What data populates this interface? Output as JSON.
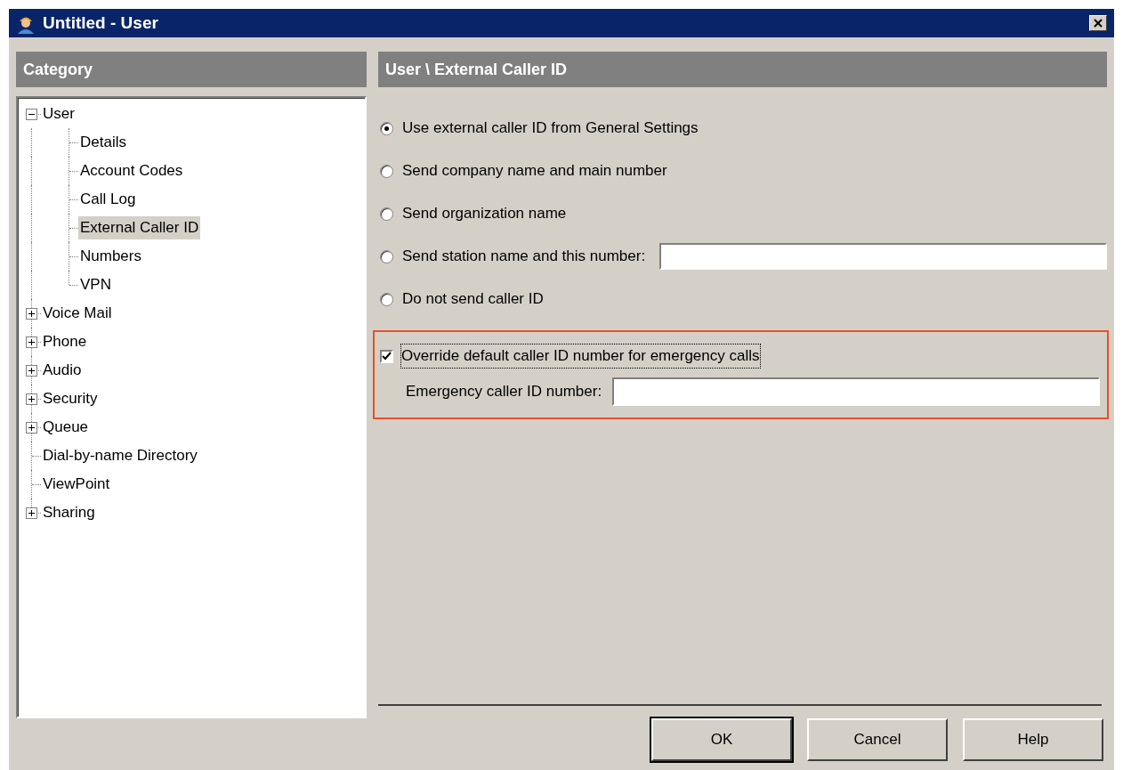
{
  "window": {
    "title": "Untitled - User"
  },
  "category": {
    "header": "Category",
    "tree": [
      {
        "label": "User",
        "expanded": true,
        "selected": false,
        "children": [
          {
            "label": "Details",
            "selected": false
          },
          {
            "label": "Account Codes",
            "selected": false
          },
          {
            "label": "Call Log",
            "selected": false
          },
          {
            "label": "External Caller ID",
            "selected": true
          },
          {
            "label": "Numbers",
            "selected": false
          },
          {
            "label": "VPN",
            "selected": false
          }
        ]
      },
      {
        "label": "Voice Mail",
        "expanded": false,
        "selected": false
      },
      {
        "label": "Phone",
        "expanded": false,
        "selected": false
      },
      {
        "label": "Audio",
        "expanded": false,
        "selected": false
      },
      {
        "label": "Security",
        "expanded": false,
        "selected": false
      },
      {
        "label": "Queue",
        "expanded": false,
        "selected": false
      },
      {
        "label": "Dial-by-name Directory",
        "selected": false
      },
      {
        "label": "ViewPoint",
        "selected": false
      },
      {
        "label": "Sharing",
        "expanded": false,
        "selected": false
      }
    ]
  },
  "panel": {
    "header": "User \\ External Caller ID",
    "options": [
      {
        "label": "Use external caller ID from General Settings",
        "selected": true
      },
      {
        "label": "Send company name and main number",
        "selected": false
      },
      {
        "label": "Send organization name",
        "selected": false
      },
      {
        "label": "Send station name and this number:",
        "selected": false,
        "has_field": true
      },
      {
        "label": "Do not send caller ID",
        "selected": false
      }
    ],
    "emergency": {
      "highlighted": true,
      "override": {
        "label": "Override default caller ID number for emergency calls",
        "checked": true
      },
      "field_label": "Emergency caller ID number:"
    }
  },
  "buttons": [
    {
      "label": "OK",
      "default": true
    },
    {
      "label": "Cancel",
      "default": false
    },
    {
      "label": "Help",
      "default": false
    }
  ]
}
